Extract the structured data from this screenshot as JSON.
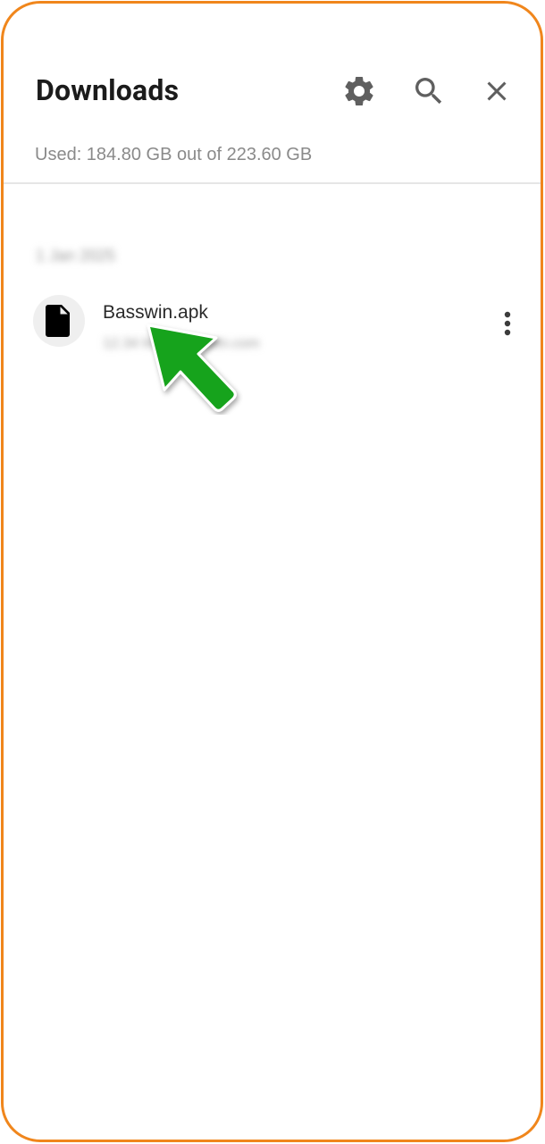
{
  "header": {
    "title": "Downloads",
    "icons": [
      "gear-icon",
      "search-icon",
      "close-icon"
    ]
  },
  "storage": {
    "usage_text": "Used: 184.80 GB out of 223.60 GB"
  },
  "downloads": {
    "groups": [
      {
        "date_label": "1 Jan 2025",
        "items": [
          {
            "name": "Basswin.apk",
            "meta": "12.34 MB • basswin.com",
            "icon": "document-icon",
            "menu_icon": "more-vert-icon"
          }
        ]
      }
    ]
  },
  "annotation": {
    "arrow_color": "#19a31b",
    "arrow_icon": "pointer-arrow"
  },
  "colors": {
    "frame_border": "#f0861c",
    "text_primary": "#1b1b1b",
    "text_secondary": "#8a8a8a",
    "icon": "#5f5f5f"
  }
}
